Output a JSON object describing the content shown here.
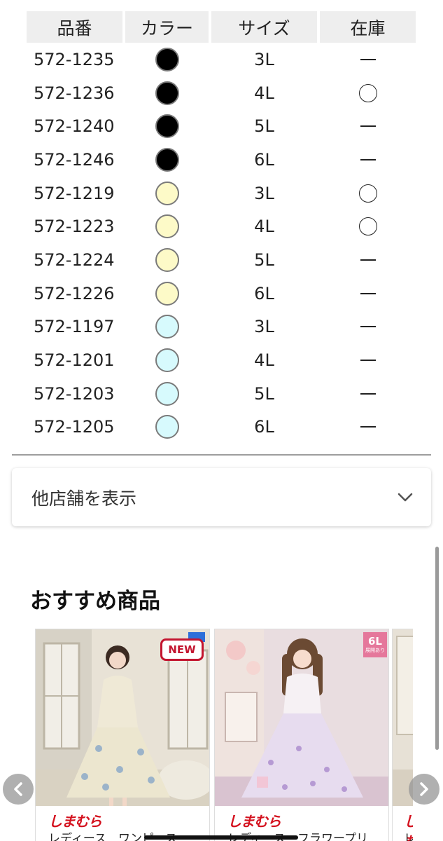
{
  "table": {
    "headers": {
      "part_no": "品番",
      "color": "カラー",
      "size": "サイズ",
      "stock": "在庫"
    },
    "rows": [
      {
        "part_no": "572-1235",
        "color": "#000000",
        "size": "3L",
        "stock": "ー"
      },
      {
        "part_no": "572-1236",
        "color": "#000000",
        "size": "4L",
        "stock": "〇"
      },
      {
        "part_no": "572-1240",
        "color": "#000000",
        "size": "5L",
        "stock": "ー"
      },
      {
        "part_no": "572-1246",
        "color": "#000000",
        "size": "6L",
        "stock": "ー"
      },
      {
        "part_no": "572-1219",
        "color": "#fdfac8",
        "size": "3L",
        "stock": "〇"
      },
      {
        "part_no": "572-1223",
        "color": "#fdfac8",
        "size": "4L",
        "stock": "〇"
      },
      {
        "part_no": "572-1224",
        "color": "#fdfac8",
        "size": "5L",
        "stock": "ー"
      },
      {
        "part_no": "572-1226",
        "color": "#fdfac8",
        "size": "6L",
        "stock": "ー"
      },
      {
        "part_no": "572-1197",
        "color": "#d7fafd",
        "size": "3L",
        "stock": "ー"
      },
      {
        "part_no": "572-1201",
        "color": "#d7fafd",
        "size": "4L",
        "stock": "ー"
      },
      {
        "part_no": "572-1203",
        "color": "#d7fafd",
        "size": "5L",
        "stock": "ー"
      },
      {
        "part_no": "572-1205",
        "color": "#d7fafd",
        "size": "6L",
        "stock": "ー"
      }
    ]
  },
  "other_stores": {
    "label": "他店舗を表示",
    "icon": "chevron-down-icon"
  },
  "recommendations": {
    "title": "おすすめ商品",
    "products": [
      {
        "brand": "しまむら",
        "name": "レディース　ワンピース",
        "badge": "NEW",
        "tag": ""
      },
      {
        "brand": "しまむら",
        "name": "レディース　フラワープリ",
        "badge": "6L",
        "badge_sub": "展開あり"
      },
      {
        "brand": "しまむら",
        "name": "レ"
      }
    ],
    "prev_icon": "chevron-left-icon",
    "next_icon": "chevron-right-icon"
  },
  "colors": {
    "brand_red": "#d4111e",
    "header_bg": "#eeeeee",
    "new_badge": "#c3152f",
    "size_badge": "#e5779b"
  }
}
